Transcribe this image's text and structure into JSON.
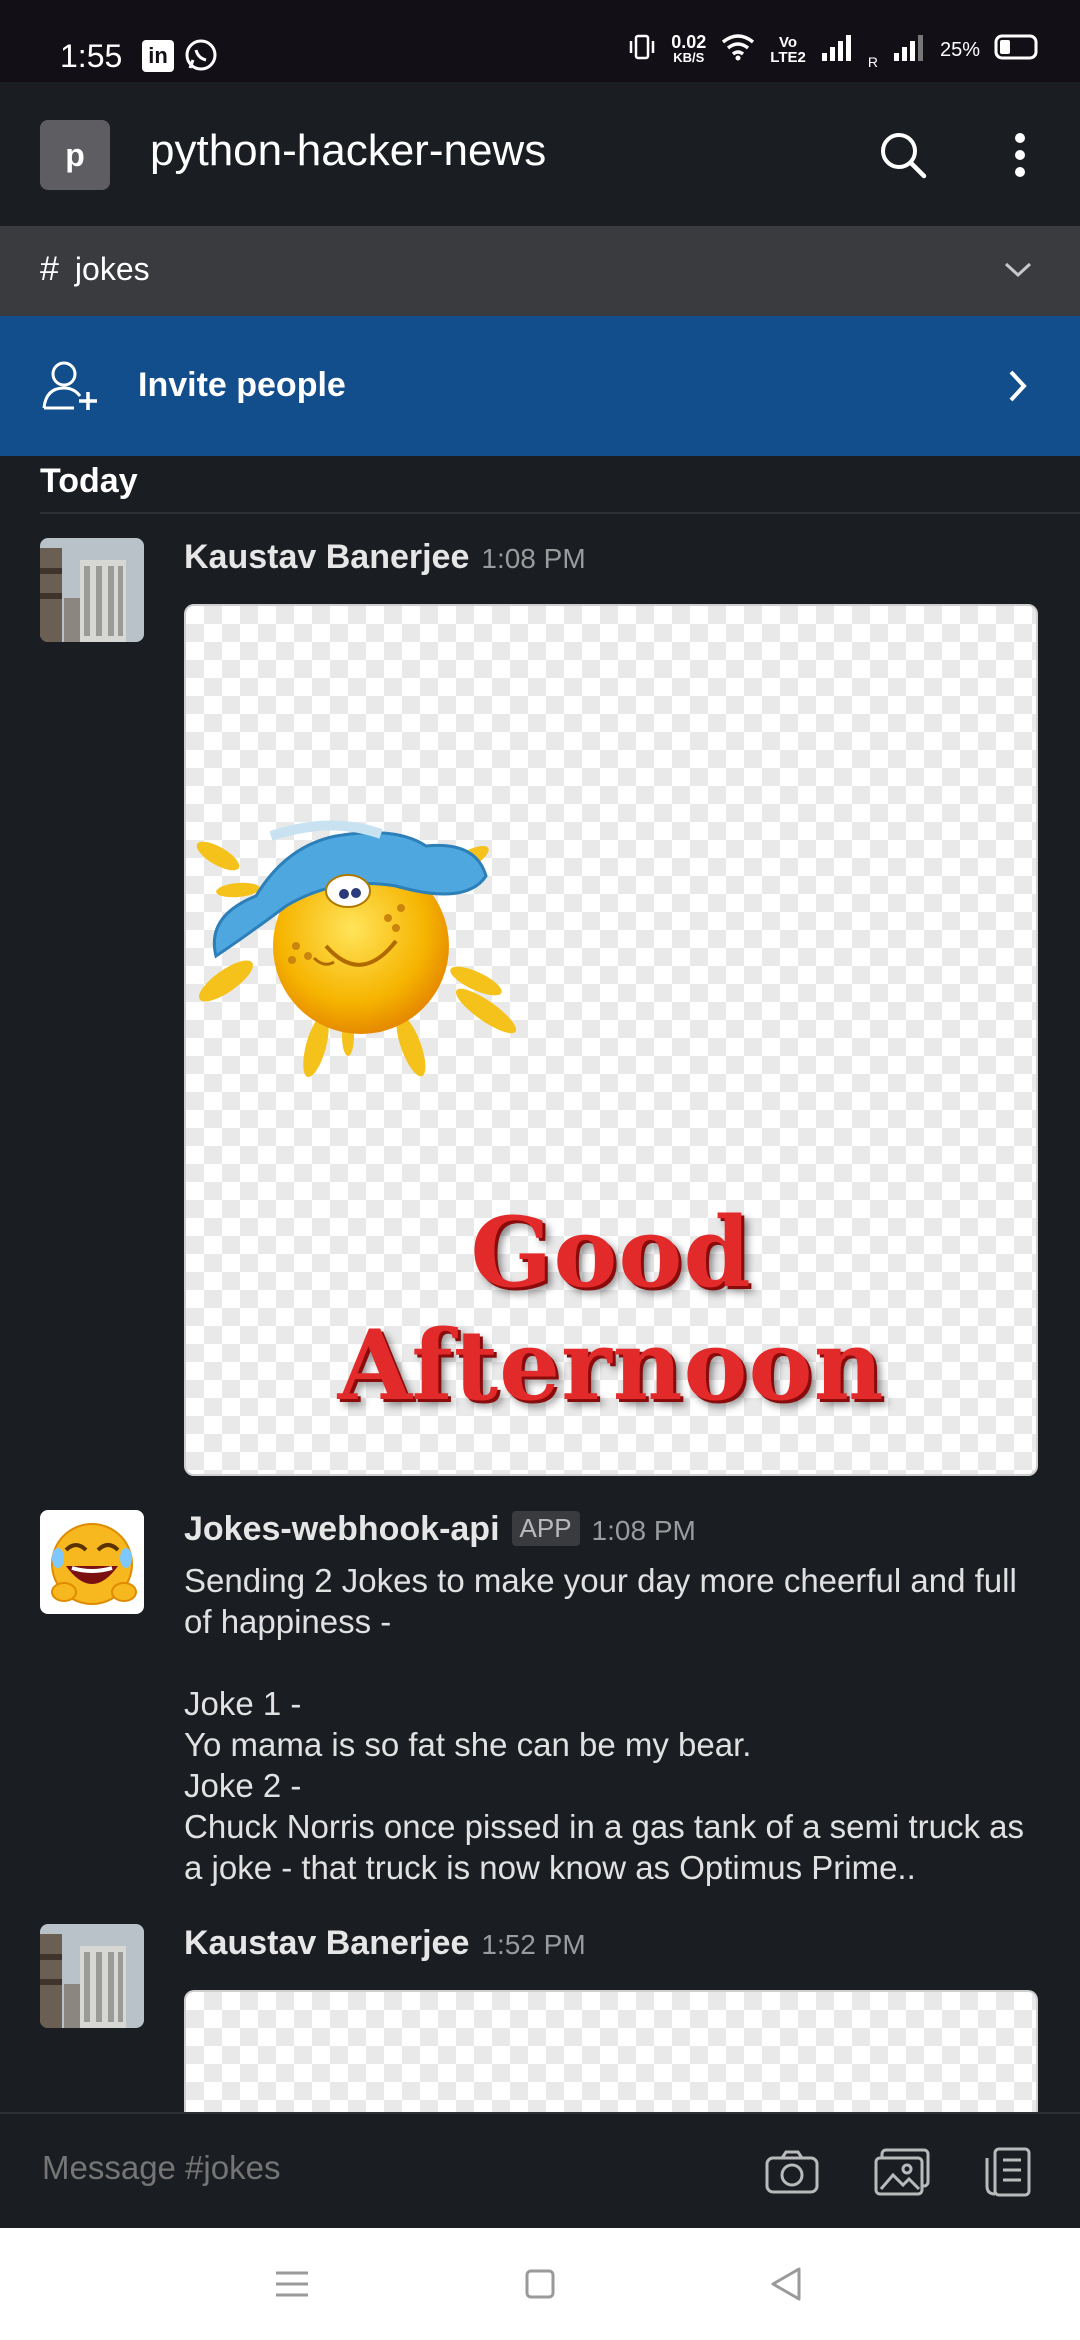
{
  "status_bar": {
    "time": "1:55",
    "net_speed_value": "0.02",
    "net_speed_unit": "KB/S",
    "volte_top": "Vo",
    "volte_bottom": "LTE2",
    "roaming": "R",
    "battery": "25%"
  },
  "header": {
    "workspace_initial": "p",
    "workspace_name": "python-hacker-news"
  },
  "channel": {
    "hash": "#",
    "name": "jokes"
  },
  "invite": {
    "label": "Invite people"
  },
  "feed": {
    "day_divider": "Today",
    "messages": [
      {
        "author": "Kaustav Banerjee",
        "time": "1:08 PM",
        "image_text": "Good Afternoon"
      },
      {
        "author": "Jokes-webhook-api",
        "badge": "APP",
        "time": "1:08 PM",
        "lines": [
          "Sending 2 Jokes to make your day more cheerful and full of happiness -",
          "",
          "Joke 1 -",
          "Yo mama is so fat she can be my bear.",
          "Joke 2 -",
          "Chuck Norris once pissed in a gas tank of a semi truck as a joke - that truck is now know as Optimus Prime.."
        ]
      },
      {
        "author": "Kaustav Banerjee",
        "time": "1:52 PM"
      }
    ]
  },
  "composer": {
    "placeholder": "Message #jokes"
  },
  "colors": {
    "background": "#1a1d21",
    "invite_banner": "#124e8c",
    "channel_bar": "#3a3b3e",
    "status_bar": "#121016"
  }
}
